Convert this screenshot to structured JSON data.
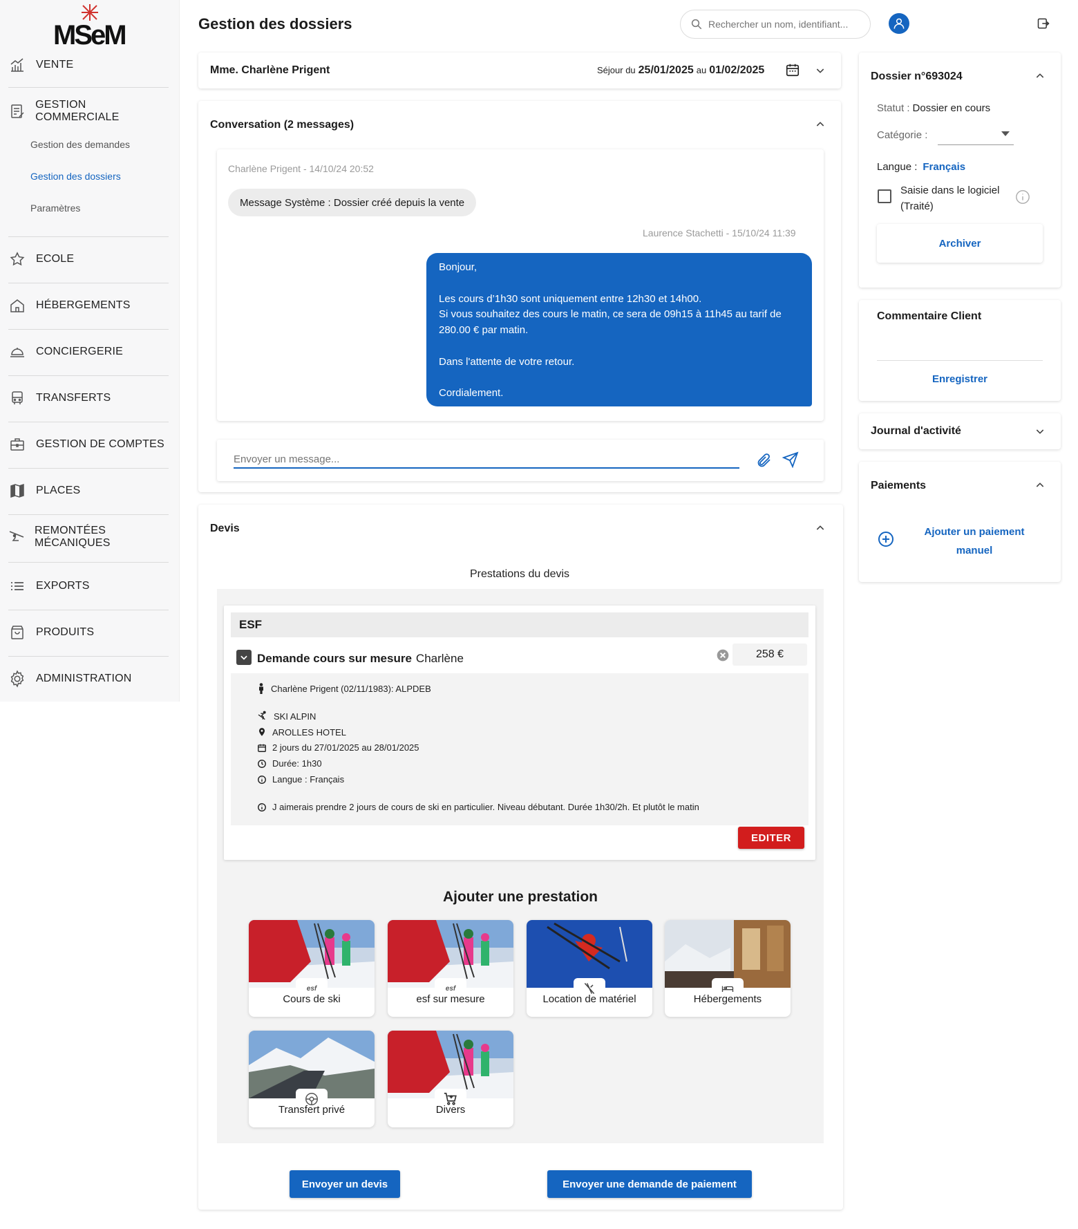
{
  "brand": {
    "logo_text": "MSeM"
  },
  "sidebar": {
    "items": [
      {
        "label": "VENTE",
        "icon": "chart-bars-icon"
      },
      {
        "label": "GESTION COMMERCIALE",
        "icon": "document-edit-icon"
      },
      {
        "label": "ECOLE",
        "icon": "star-icon"
      },
      {
        "label": "HÉBERGEMENTS",
        "icon": "house-icon"
      },
      {
        "label": "CONCIERGERIE",
        "icon": "service-bell-icon"
      },
      {
        "label": "TRANSFERTS",
        "icon": "bus-icon"
      },
      {
        "label": "GESTION DE COMPTES",
        "icon": "briefcase-icon"
      },
      {
        "label": "PLACES",
        "icon": "map-icon"
      },
      {
        "label": "REMONTÉES MÉCANIQUES",
        "icon": "ski-lift-icon"
      },
      {
        "label": "EXPORTS",
        "icon": "list-icon"
      },
      {
        "label": "PRODUITS",
        "icon": "shopping-bag-icon"
      },
      {
        "label": "ADMINISTRATION",
        "icon": "gear-icon"
      }
    ],
    "subitems": [
      {
        "label": "Gestion des demandes",
        "active": false
      },
      {
        "label": "Gestion des dossiers",
        "active": true
      },
      {
        "label": "Paramètres",
        "active": false
      }
    ]
  },
  "header": {
    "title": "Gestion des dossiers",
    "search_placeholder": "Rechercher un nom, identifiant..."
  },
  "client_bar": {
    "name": "Mme. Charlène Prigent",
    "stay_prefix": "Séjour du",
    "start": "25/01/2025",
    "mid": "au",
    "end": "01/02/2025"
  },
  "conversation": {
    "title": "Conversation (2 messages)",
    "messages": [
      {
        "meta": "Charlène Prigent - 14/10/24 20:52",
        "text": "Message Système : Dossier créé depuis la vente"
      },
      {
        "meta": "Laurence Stachetti - 15/10/24 11:39",
        "lines": [
          "Bonjour,",
          "",
          "Les cours d’1h30 sont uniquement entre 12h30 et 14h00.",
          "Si vous souhaitez des cours le matin, ce sera de 09h15 à 11h45 au tarif de",
          "280.00 € par matin.",
          "",
          "Dans l'attente de votre retour.",
          "",
          "Cordialement."
        ]
      }
    ],
    "input_placeholder": "Envoyer un message..."
  },
  "devis": {
    "title": "Devis",
    "subtitle": "Prestations du devis",
    "group": "ESF",
    "item": {
      "title": "Demande cours sur mesure",
      "person": "Charlène",
      "price": "258 €",
      "details": [
        {
          "icon": "person-icon",
          "text": "Charlène Prigent (02/11/1983): ALPDEB"
        },
        {
          "icon": "skier-icon",
          "text": "SKI ALPIN"
        },
        {
          "icon": "location-pin-icon",
          "text": "AROLLES HOTEL"
        },
        {
          "icon": "calendar-icon",
          "text": "2 jours du 27/01/2025 au 28/01/2025"
        },
        {
          "icon": "clock-icon",
          "text": "Durée: 1h30"
        },
        {
          "icon": "info-icon",
          "text": "Langue : Français"
        },
        {
          "icon": "info-icon",
          "text": "J aimerais prendre 2 jours de cours de ski en particulier. Niveau débutant. Durée 1h30/2h. Et plutôt le matin"
        }
      ],
      "edit_label": "EDITER"
    },
    "add_title": "Ajouter une prestation",
    "prestations": [
      {
        "label": "Cours de ski",
        "badge": "esf"
      },
      {
        "label": "esf sur mesure",
        "badge": "esf"
      },
      {
        "label": "Location de matériel",
        "badge": ""
      },
      {
        "label": "Hébergements",
        "badge": ""
      },
      {
        "label": "Transfert privé",
        "badge": ""
      },
      {
        "label": "Divers",
        "badge": ""
      }
    ],
    "send_quote": "Envoyer un devis",
    "send_payment": "Envoyer une demande de paiement"
  },
  "dossier": {
    "title": "Dossier n°693024",
    "status_label": "Statut :",
    "status_value": "Dossier en cours",
    "category_label": "Catégorie :",
    "language_label": "Langue :",
    "language_value": "Français",
    "checkbox_label_1": "Saisie dans le logiciel",
    "checkbox_label_2": "(Traité)",
    "archive": "Archiver"
  },
  "comment": {
    "title": "Commentaire Client",
    "save": "Enregistrer"
  },
  "journal": {
    "title": "Journal d'activité"
  },
  "payments": {
    "title": "Paiements",
    "add_1": "Ajouter un paiement",
    "add_2": "manuel"
  },
  "colors": {
    "accent": "#1565c0",
    "danger": "#d21d1d"
  }
}
